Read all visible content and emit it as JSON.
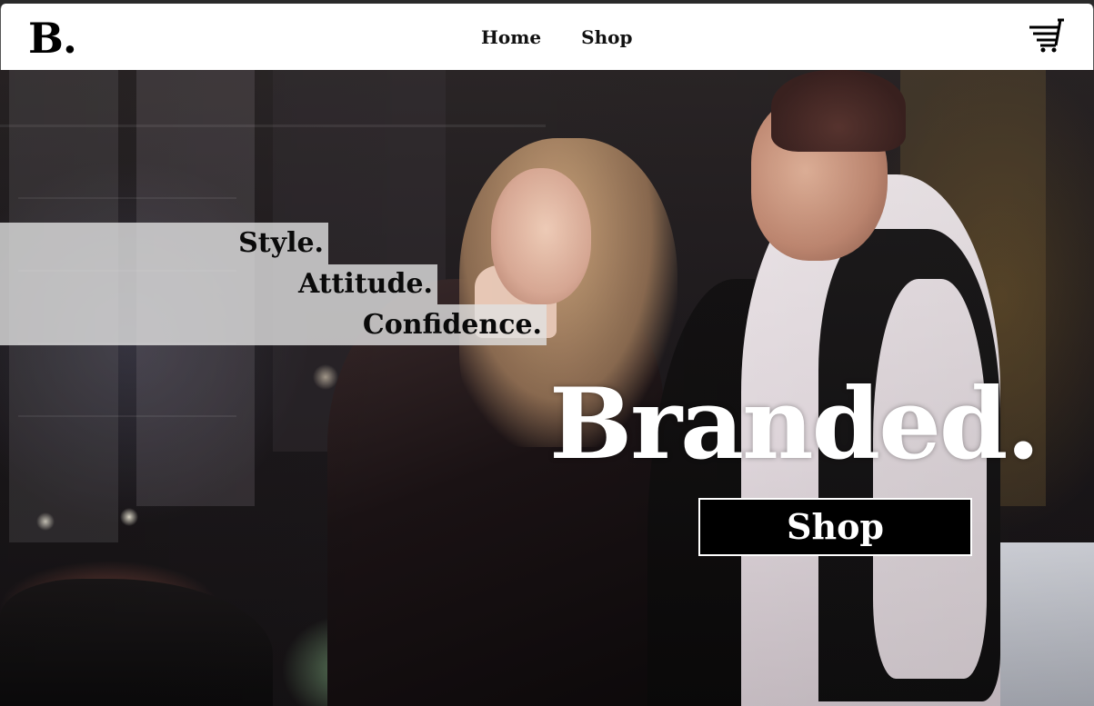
{
  "header": {
    "logo": "B.",
    "nav": [
      {
        "label": "Home"
      },
      {
        "label": "Shop"
      }
    ],
    "cart_icon": "cart-icon"
  },
  "hero": {
    "taglines": [
      "Style.",
      "Attitude.",
      "Confidence."
    ],
    "headline": "Branded.",
    "cta_label": "Shop",
    "photo": "hero-photo-couple-night-city"
  },
  "colors": {
    "nav_bg": "#ffffff",
    "text_dark": "#000000",
    "headline": "#ffffff",
    "band": "#e1e1e1",
    "button_bg": "#000000",
    "button_border": "#ffffff"
  }
}
